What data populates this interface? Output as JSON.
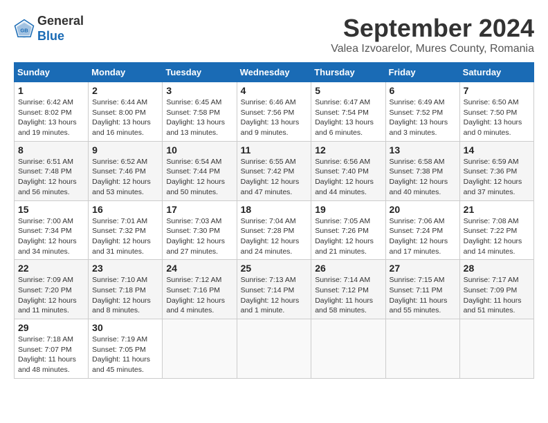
{
  "logo": {
    "line1": "General",
    "line2": "Blue"
  },
  "title": "September 2024",
  "location": "Valea Izvoarelor, Mures County, Romania",
  "headers": [
    "Sunday",
    "Monday",
    "Tuesday",
    "Wednesday",
    "Thursday",
    "Friday",
    "Saturday"
  ],
  "weeks": [
    [
      {
        "day": "1",
        "info": "Sunrise: 6:42 AM\nSunset: 8:02 PM\nDaylight: 13 hours and 19 minutes."
      },
      {
        "day": "2",
        "info": "Sunrise: 6:44 AM\nSunset: 8:00 PM\nDaylight: 13 hours and 16 minutes."
      },
      {
        "day": "3",
        "info": "Sunrise: 6:45 AM\nSunset: 7:58 PM\nDaylight: 13 hours and 13 minutes."
      },
      {
        "day": "4",
        "info": "Sunrise: 6:46 AM\nSunset: 7:56 PM\nDaylight: 13 hours and 9 minutes."
      },
      {
        "day": "5",
        "info": "Sunrise: 6:47 AM\nSunset: 7:54 PM\nDaylight: 13 hours and 6 minutes."
      },
      {
        "day": "6",
        "info": "Sunrise: 6:49 AM\nSunset: 7:52 PM\nDaylight: 13 hours and 3 minutes."
      },
      {
        "day": "7",
        "info": "Sunrise: 6:50 AM\nSunset: 7:50 PM\nDaylight: 13 hours and 0 minutes."
      }
    ],
    [
      {
        "day": "8",
        "info": "Sunrise: 6:51 AM\nSunset: 7:48 PM\nDaylight: 12 hours and 56 minutes."
      },
      {
        "day": "9",
        "info": "Sunrise: 6:52 AM\nSunset: 7:46 PM\nDaylight: 12 hours and 53 minutes."
      },
      {
        "day": "10",
        "info": "Sunrise: 6:54 AM\nSunset: 7:44 PM\nDaylight: 12 hours and 50 minutes."
      },
      {
        "day": "11",
        "info": "Sunrise: 6:55 AM\nSunset: 7:42 PM\nDaylight: 12 hours and 47 minutes."
      },
      {
        "day": "12",
        "info": "Sunrise: 6:56 AM\nSunset: 7:40 PM\nDaylight: 12 hours and 44 minutes."
      },
      {
        "day": "13",
        "info": "Sunrise: 6:58 AM\nSunset: 7:38 PM\nDaylight: 12 hours and 40 minutes."
      },
      {
        "day": "14",
        "info": "Sunrise: 6:59 AM\nSunset: 7:36 PM\nDaylight: 12 hours and 37 minutes."
      }
    ],
    [
      {
        "day": "15",
        "info": "Sunrise: 7:00 AM\nSunset: 7:34 PM\nDaylight: 12 hours and 34 minutes."
      },
      {
        "day": "16",
        "info": "Sunrise: 7:01 AM\nSunset: 7:32 PM\nDaylight: 12 hours and 31 minutes."
      },
      {
        "day": "17",
        "info": "Sunrise: 7:03 AM\nSunset: 7:30 PM\nDaylight: 12 hours and 27 minutes."
      },
      {
        "day": "18",
        "info": "Sunrise: 7:04 AM\nSunset: 7:28 PM\nDaylight: 12 hours and 24 minutes."
      },
      {
        "day": "19",
        "info": "Sunrise: 7:05 AM\nSunset: 7:26 PM\nDaylight: 12 hours and 21 minutes."
      },
      {
        "day": "20",
        "info": "Sunrise: 7:06 AM\nSunset: 7:24 PM\nDaylight: 12 hours and 17 minutes."
      },
      {
        "day": "21",
        "info": "Sunrise: 7:08 AM\nSunset: 7:22 PM\nDaylight: 12 hours and 14 minutes."
      }
    ],
    [
      {
        "day": "22",
        "info": "Sunrise: 7:09 AM\nSunset: 7:20 PM\nDaylight: 12 hours and 11 minutes."
      },
      {
        "day": "23",
        "info": "Sunrise: 7:10 AM\nSunset: 7:18 PM\nDaylight: 12 hours and 8 minutes."
      },
      {
        "day": "24",
        "info": "Sunrise: 7:12 AM\nSunset: 7:16 PM\nDaylight: 12 hours and 4 minutes."
      },
      {
        "day": "25",
        "info": "Sunrise: 7:13 AM\nSunset: 7:14 PM\nDaylight: 12 hours and 1 minute."
      },
      {
        "day": "26",
        "info": "Sunrise: 7:14 AM\nSunset: 7:12 PM\nDaylight: 11 hours and 58 minutes."
      },
      {
        "day": "27",
        "info": "Sunrise: 7:15 AM\nSunset: 7:11 PM\nDaylight: 11 hours and 55 minutes."
      },
      {
        "day": "28",
        "info": "Sunrise: 7:17 AM\nSunset: 7:09 PM\nDaylight: 11 hours and 51 minutes."
      }
    ],
    [
      {
        "day": "29",
        "info": "Sunrise: 7:18 AM\nSunset: 7:07 PM\nDaylight: 11 hours and 48 minutes."
      },
      {
        "day": "30",
        "info": "Sunrise: 7:19 AM\nSunset: 7:05 PM\nDaylight: 11 hours and 45 minutes."
      },
      null,
      null,
      null,
      null,
      null
    ]
  ]
}
